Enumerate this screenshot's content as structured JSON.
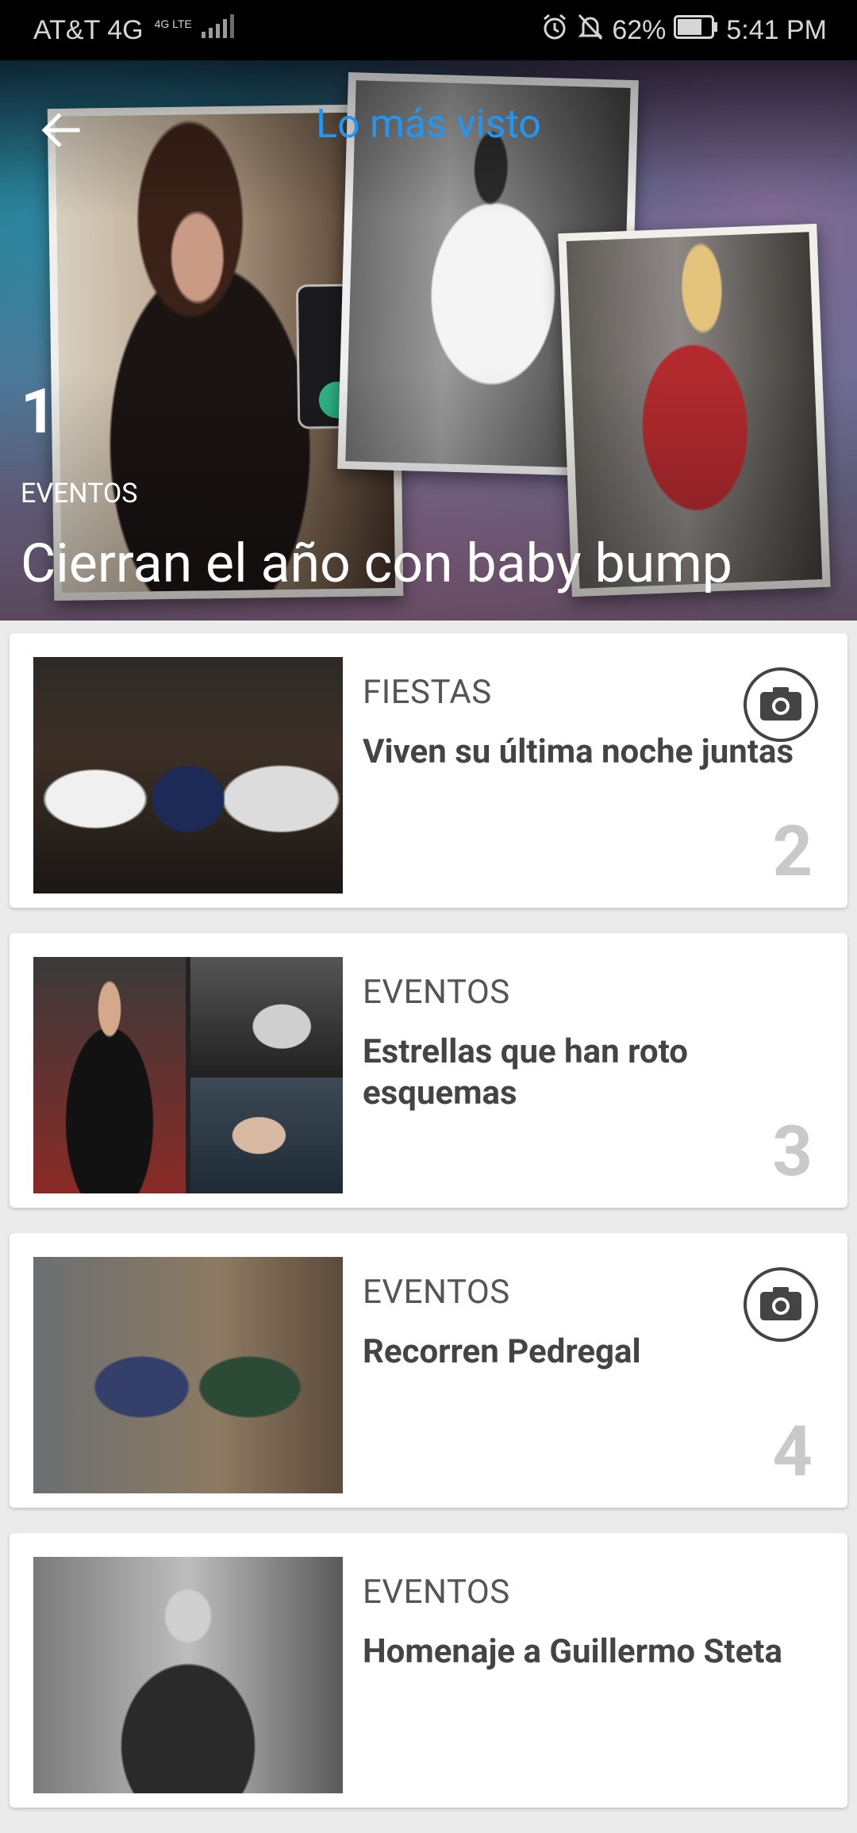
{
  "status_bar": {
    "carrier": "AT&T 4G",
    "network_sup": "4G LTE",
    "battery": "62%",
    "time": "5:41 PM",
    "icons": [
      "alarm-icon",
      "bell-off-icon",
      "battery-icon",
      "signal-icon"
    ]
  },
  "header": {
    "title": "Lo más visto"
  },
  "hero": {
    "rank": "1",
    "category": "EVENTOS",
    "headline": "Cierran el año con baby bump"
  },
  "articles": [
    {
      "category": "FIESTAS",
      "title": "Viven su última noche juntas",
      "rank": "2",
      "gallery": true
    },
    {
      "category": "EVENTOS",
      "title": "Estrellas que han roto esquemas",
      "rank": "3",
      "gallery": false
    },
    {
      "category": "EVENTOS",
      "title": "Recorren Pedregal",
      "rank": "4",
      "gallery": true
    },
    {
      "category": "EVENTOS",
      "title": "Homenaje a Guillermo Steta",
      "rank": "",
      "gallery": false
    }
  ],
  "colors": {
    "accent": "#2196f3",
    "rank_gray": "#c9c9c9",
    "card_bg": "#ffffff",
    "page_bg": "#ebebeb"
  }
}
